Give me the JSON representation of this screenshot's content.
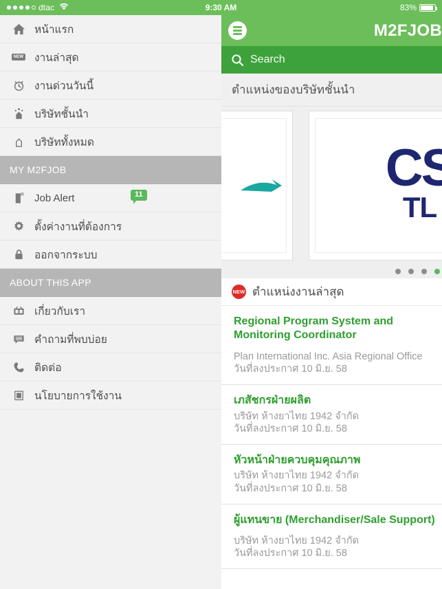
{
  "status_bar": {
    "carrier": "dtac",
    "signal_filled": 4,
    "signal_empty": 1,
    "wifi_icon": "wifi-icon",
    "time": "9:30 AM",
    "battery_percent": "83%",
    "battery_level": 83
  },
  "sidebar": {
    "items": [
      {
        "label": "หน้าแรก",
        "icon": "home-icon",
        "latin": false
      },
      {
        "label": "งานล่าสุด",
        "icon": "new-tag-icon",
        "latin": false
      },
      {
        "label": "งานด่วนวันนี้",
        "icon": "alarm-clock-icon",
        "latin": false
      },
      {
        "label": "บริษัทชั้นนำ",
        "icon": "featured-building-icon",
        "latin": false
      },
      {
        "label": "บริษัททั้งหมด",
        "icon": "building-icon",
        "latin": false
      }
    ],
    "my_section": {
      "header": "MY M2FJOB",
      "items": [
        {
          "label": "Job Alert",
          "icon": "document-alert-icon",
          "badge": "11",
          "latin": true
        },
        {
          "label": "ตั้งค่างานที่ต้องการ",
          "icon": "gear-icon",
          "latin": false
        },
        {
          "label": "ออกจากระบบ",
          "icon": "lock-icon",
          "latin": false
        }
      ]
    },
    "about_section": {
      "header": "ABOUT THIS APP",
      "items": [
        {
          "label": "เกี่ยวกับเรา",
          "icon": "info-radio-icon",
          "latin": false
        },
        {
          "label": "คำถามที่พบบ่อย",
          "icon": "speech-bubble-icon",
          "latin": false
        },
        {
          "label": "ติดต่อ",
          "icon": "phone-icon",
          "latin": false
        },
        {
          "label": "นโยบายการใช้งาน",
          "icon": "policy-book-icon",
          "latin": false
        }
      ]
    }
  },
  "app_bar": {
    "menu_icon": "hamburger-menu-icon",
    "title": "M2FJOB"
  },
  "search": {
    "icon": "search-icon",
    "placeholder": "Search",
    "value": ""
  },
  "featured": {
    "section_title": "ตำแหน่งของบริษัทชั้นนำ",
    "cards": [
      {
        "logo_name": "teal-swoosh-logo",
        "mark": "",
        "wordmark": ""
      },
      {
        "logo_name": "navy-cs-tl-logo",
        "mark": "CS",
        "wordmark": "TL"
      }
    ],
    "pager_dots": 4,
    "pager_active_index": 3
  },
  "latest_jobs": {
    "badge": "NEW",
    "section_title": "ตำแหน่งงานล่าสุด",
    "items": [
      {
        "title": "Regional Program System and Monitoring Coordinator",
        "company": " Plan International Inc. Asia Regional Office",
        "date": "วันที่ลงประกาศ 10 มิ.ย. 58"
      },
      {
        "title": "เภสัชกรฝ่ายผลิต",
        "company": "บริษัท ห้างยาไทย 1942 จำกัด",
        "date": "วันที่ลงประกาศ 10 มิ.ย. 58"
      },
      {
        "title": "หัวหน้าฝ่ายควบคุมคุณภาพ",
        "company": "บริษัท ห้างยาไทย 1942 จำกัด",
        "date": "วันที่ลงประกาศ 10 มิ.ย. 58"
      },
      {
        "title": "ผู้แทนขาย (Merchandiser/Sale Support)",
        "company": "บริษัท ห้างยาไทย 1942 จำกัด",
        "date": "วันที่ลงประกาศ 10 มิ.ย. 58"
      }
    ]
  },
  "colors": {
    "brand_green": "#6cbe5a",
    "search_green": "#3da23b",
    "job_title_green": "#2f9e2f",
    "badge_green": "#5cb85c",
    "new_red": "#e02b2b",
    "section_gray": "#b6b6b6",
    "logo_navy": "#1f2670"
  }
}
